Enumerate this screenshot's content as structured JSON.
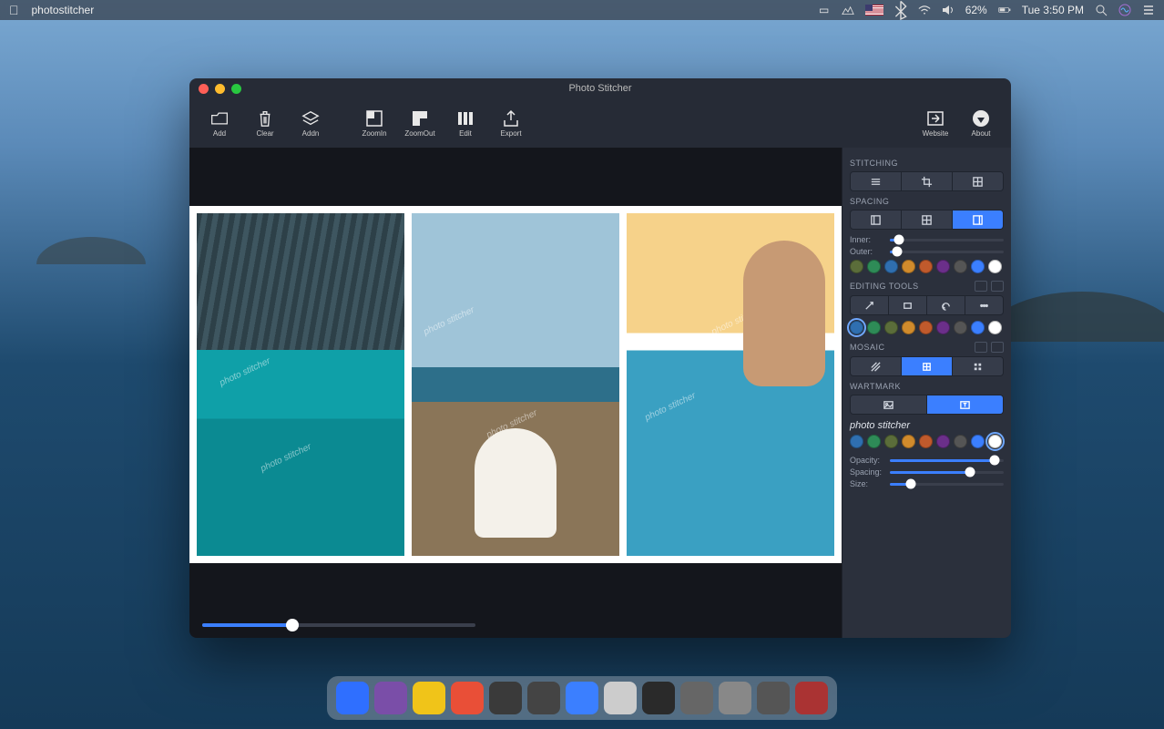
{
  "menubar": {
    "app_name": "photostitcher",
    "battery": "62%",
    "clock": "Tue 3:50 PM"
  },
  "window": {
    "title": "Photo Stitcher"
  },
  "toolbar": {
    "add": "Add",
    "clear": "Clear",
    "addn": "Addn",
    "zoomin": "ZoomIn",
    "zoomout": "ZoomOut",
    "edit": "Edit",
    "export": "Export",
    "website": "Website",
    "about": "About"
  },
  "canvas": {
    "watermark_text": "photo stitcher",
    "zoom_slider_percent": 33
  },
  "panel": {
    "stitching_label": "STITCHING",
    "spacing_label": "SPACING",
    "inner_label": "Inner:",
    "outer_label": "Outer:",
    "inner_percent": 8,
    "outer_percent": 6,
    "editing_label": "EDITING TOOLS",
    "mosaic_label": "MOSAIC",
    "watermark_label": "WARTMARK",
    "watermark_text": "photo stitcher",
    "opacity_label": "Opacity:",
    "wspacing_label": "Spacing:",
    "size_label": "Size:",
    "opacity_percent": 92,
    "wspacing_percent": 70,
    "size_percent": 18,
    "spacing_swatches": [
      "#5b6d3a",
      "#2e8b57",
      "#2f6fb0",
      "#d18b2c",
      "#c05a2c",
      "#6b2f8a",
      "#555",
      "#3b7fff",
      "#fff"
    ],
    "editing_swatches": [
      "#2f6fb0",
      "#2e8b57",
      "#5b6d3a",
      "#d18b2c",
      "#c05a2c",
      "#6b2f8a",
      "#555",
      "#3b7fff",
      "#fff"
    ],
    "watermark_swatches": [
      "#2f6fb0",
      "#2e8b57",
      "#5b6d3a",
      "#d18b2c",
      "#c05a2c",
      "#6b2f8a",
      "#555",
      "#3b7fff",
      "#fff"
    ]
  },
  "dock": {
    "colors": [
      "#2f6fff",
      "#7a4ea8",
      "#f0c419",
      "#e94f37",
      "#3a3a3a",
      "#444",
      "#3b7fff",
      "#ccc",
      "#2a2a2a",
      "#666",
      "#888",
      "#555",
      "#a33"
    ]
  }
}
